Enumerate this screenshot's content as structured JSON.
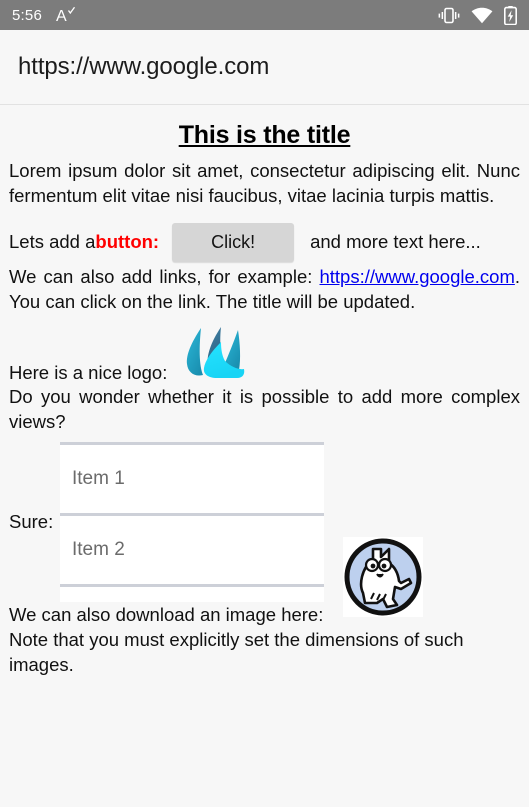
{
  "statusbar": {
    "time": "5:56",
    "icons": {
      "accessibility": "font-size-a-check-icon",
      "vibrate": "vibrate-icon",
      "wifi": "wifi-icon",
      "battery": "battery-charging-icon"
    }
  },
  "browser": {
    "url": "https://www.google.com"
  },
  "page": {
    "title": "This is the title",
    "paragraph1": "Lorem ipsum dolor sit amet, consectetur adipiscing elit. Nunc fermentum elit vitae nisi faucibus, vitae lacinia turpis mattis.",
    "button_row": {
      "text_before": "Lets add a ",
      "emphasis": "button:",
      "button_label": "Click!",
      "text_after": "and more text here..."
    },
    "link_row": {
      "text_before": "We can also add links, for example: ",
      "link_text": "https://www.google.com",
      "text_after": ". You can click on the link. The title will be updated."
    },
    "logo_row": {
      "label": "Here is a nice logo:",
      "logo_name": "blue-flame-logo"
    },
    "question": "Do you wonder whether it is possible to add more complex views?",
    "list_section": {
      "label": "Sure:",
      "items": [
        {
          "label": "Item 1"
        },
        {
          "label": "Item 2"
        },
        {
          "label": ""
        }
      ]
    },
    "image_section": {
      "caption": "We can also download an image here:",
      "image_name": "simons-cat-logo",
      "note": "Note that you must explicitly set the dimensions of such images."
    }
  },
  "colors": {
    "statusbar_bg": "#7c7c7c",
    "page_bg": "#f7f7f7",
    "emphasis_red": "#ff0000",
    "link_blue": "#0000ee",
    "button_gray": "#d6d6d6",
    "list_divider": "#cdd0d8"
  }
}
